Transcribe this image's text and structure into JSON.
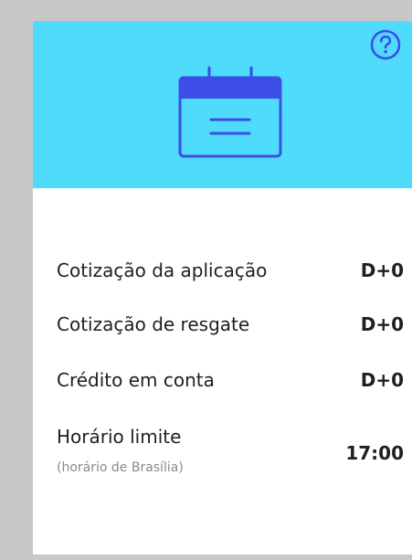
{
  "card": {
    "accent_color": "#4fdbfb",
    "icon_color": "#3e4de8",
    "help_icon": "question-circle-icon",
    "header_icon": "calendar-icon"
  },
  "rows": [
    {
      "label": "Cotização da aplicação",
      "value": "D+0"
    },
    {
      "label": "Cotização de resgate",
      "value": "D+0"
    },
    {
      "label": "Crédito em conta",
      "value": "D+0"
    },
    {
      "label": "Horário limite",
      "sublabel": "(horário de Brasília)",
      "value": "17:00"
    }
  ]
}
